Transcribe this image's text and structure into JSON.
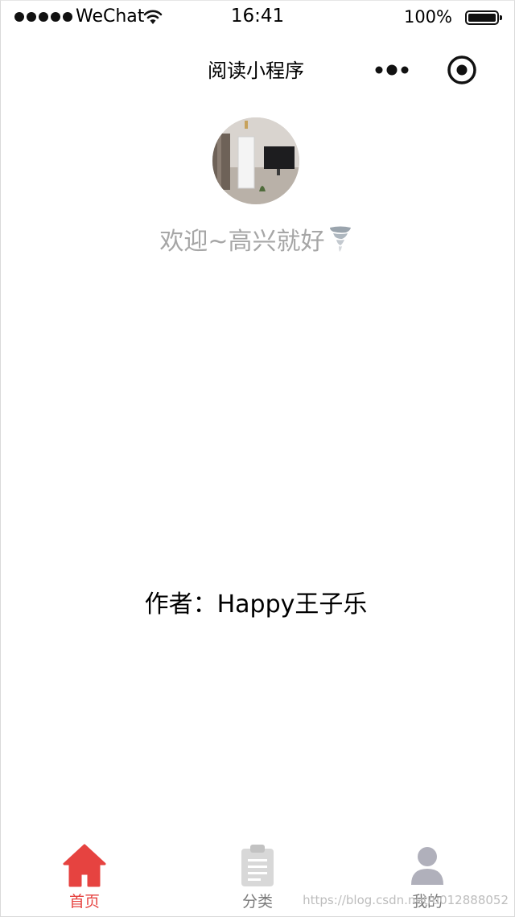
{
  "status_bar": {
    "carrier": "WeChat",
    "time": "16:41",
    "battery": "100%"
  },
  "nav": {
    "title": "阅读小程序",
    "menu_icon": "more-dots-icon",
    "close_icon": "target-circle-icon"
  },
  "profile": {
    "welcome": "欢迎~高兴就好",
    "emoji": "tornado-icon"
  },
  "author": "作者：Happy王子乐",
  "tabs": [
    {
      "label": "首页",
      "icon": "home-icon",
      "active": true,
      "color": "#e64340"
    },
    {
      "label": "分类",
      "icon": "clipboard-icon",
      "active": false,
      "color": "#d8d8d8"
    },
    {
      "label": "我的",
      "icon": "user-icon",
      "active": false,
      "color": "#b0b0bb"
    }
  ],
  "watermark": "https://blog.csdn.net/u012888052"
}
